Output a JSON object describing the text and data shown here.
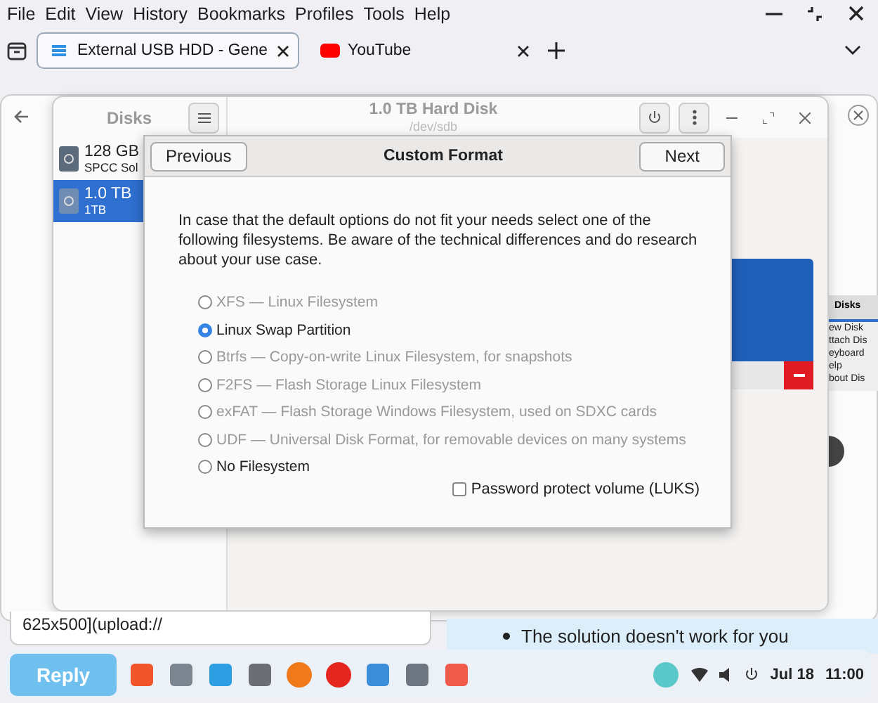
{
  "menubar": [
    "File",
    "Edit",
    "View",
    "History",
    "Bookmarks",
    "Profiles",
    "Tools",
    "Help"
  ],
  "tabs": [
    {
      "title": "External USB HDD - Gene",
      "selected": true
    },
    {
      "title": "YouTube",
      "selected": false
    }
  ],
  "side_menu": {
    "title": "Disks",
    "items": [
      "ew Disk",
      "ttach Dis",
      "eyboard",
      "elp",
      "bout Dis"
    ]
  },
  "disks_window": {
    "sidebar_title": "Disks",
    "title": "1.0 TB Hard Disk",
    "subtitle": "/dev/sdb",
    "drives": [
      {
        "name": "128 GB",
        "detail": "SPCC Sol",
        "selected": false
      },
      {
        "name": "1.0 TB",
        "detail": "1TB",
        "selected": true
      }
    ]
  },
  "dialog": {
    "title": "Custom Format",
    "previous": "Previous",
    "next": "Next",
    "description": "In case that the default options do not fit your needs select one of the following filesystems. Be aware of the technical differences and do research about your use case.",
    "options": [
      {
        "label": "XFS — Linux Filesystem",
        "selected": false,
        "disabled": true
      },
      {
        "label": "Linux Swap Partition",
        "selected": true,
        "disabled": false
      },
      {
        "label": "Btrfs — Copy-on-write Linux Filesystem, for snapshots",
        "selected": false,
        "disabled": true
      },
      {
        "label": "F2FS — Flash Storage Linux Filesystem",
        "selected": false,
        "disabled": true
      },
      {
        "label": "exFAT — Flash Storage Windows Filesystem, used on SDXC cards",
        "selected": false,
        "disabled": true
      },
      {
        "label": "UDF — Universal Disk Format, for removable devices on many systems",
        "selected": false,
        "disabled": true
      },
      {
        "label": "No Filesystem",
        "selected": false,
        "disabled": false
      }
    ],
    "password": {
      "label": "Password protect volume (LUKS)",
      "checked": false
    }
  },
  "composer_text": "625x500](upload://",
  "post_bullet": "The solution doesn't work for you",
  "reply_button": "Reply",
  "clock": {
    "date": "Jul 18",
    "time": "11:00"
  }
}
